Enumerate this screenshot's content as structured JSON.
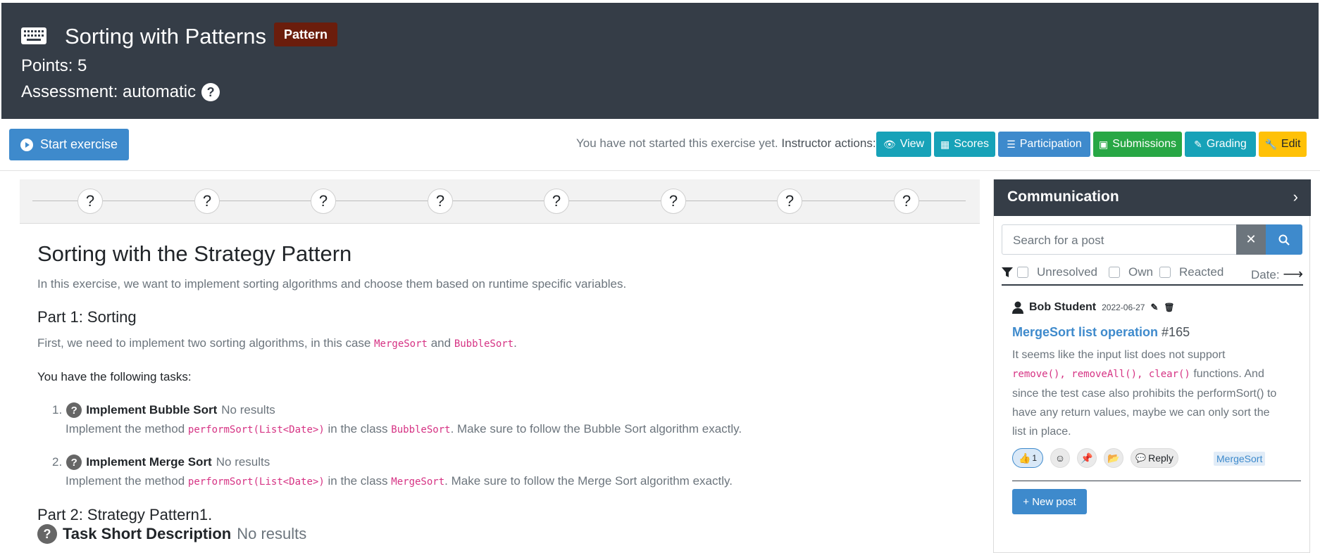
{
  "header": {
    "title": "Sorting with Patterns",
    "badge": "Pattern",
    "points": "Points: 5",
    "assessment": "Assessment: automatic",
    "keyboard_icon": "keyboard-icon",
    "help_icon": "question-circle-icon"
  },
  "toolbar": {
    "start_label": "Start exercise",
    "status_text": "You have not started this exercise yet.",
    "instructor_text": "Instructor actions:",
    "actions": [
      {
        "label": "View",
        "icon": "eye-icon",
        "color": "#17a2b8"
      },
      {
        "label": "Scores",
        "icon": "table-icon",
        "color": "#17a2b8"
      },
      {
        "label": "Participation",
        "icon": "list-icon",
        "color": "#3e8acc"
      },
      {
        "label": "Submissions",
        "icon": "book-icon",
        "color": "#28a745"
      },
      {
        "label": "Grading",
        "icon": "signature-icon",
        "color": "#17a2b8"
      },
      {
        "label": "Edit",
        "icon": "wrench-icon",
        "color": "#ffc107"
      }
    ]
  },
  "steps": [
    "?",
    "?",
    "?",
    "?",
    "?",
    "?",
    "?",
    "?"
  ],
  "problem": {
    "title": "Sorting with the Strategy Pattern",
    "intro": "In this exercise, we want to implement sorting algorithms and choose them based on runtime specific variables.",
    "part1_title": "Part 1: Sorting",
    "part1_text": "First, we need to implement two sorting algorithms, in this case",
    "code_mergesort": "MergeSort",
    "and": "and",
    "code_bubblesort": "BubbleSort",
    "tasks_intro": "You have the following tasks:",
    "tasks": [
      {
        "num": "1.",
        "title": "Implement Bubble Sort",
        "result": "No results",
        "desc_pre": "Implement the method",
        "code_method": "performSort(List<Date>)",
        "desc_mid": "in the class",
        "code_class": "BubbleSort",
        "desc_post": ". Make sure to follow the Bubble Sort algorithm exactly."
      },
      {
        "num": "2.",
        "title": "Implement Merge Sort",
        "result": "No results",
        "desc_pre": "Implement the method",
        "code_method": "performSort(List<Date>)",
        "desc_mid": "in the class",
        "code_class": "MergeSort",
        "desc_post": ". Make sure to follow the Merge Sort algorithm exactly."
      }
    ],
    "part2_title": "Part 2: Strategy Pattern1.",
    "task_short_title": "Task Short Description",
    "task_short_result": "No results"
  },
  "communication": {
    "title": "Communication",
    "search_placeholder": "Search for a post",
    "filters": [
      "Unresolved",
      "Own",
      "Reacted"
    ],
    "date_label": "Date:",
    "post": {
      "author": "Bob Student",
      "date": "2022-06-27",
      "title": "MergeSort list operation",
      "id": "#165",
      "body_1": "It seems like the input list does not support",
      "body_code": "remove(), removeAll(), clear()",
      "body_2": "functions.",
      "body_3": "And since the test case also prohibits the performSort() to have any return values, maybe we can only sort the list in place.",
      "like_count": "1",
      "reply_label": "Reply",
      "tag": "MergeSort"
    },
    "new_post_label": "+ New post"
  }
}
